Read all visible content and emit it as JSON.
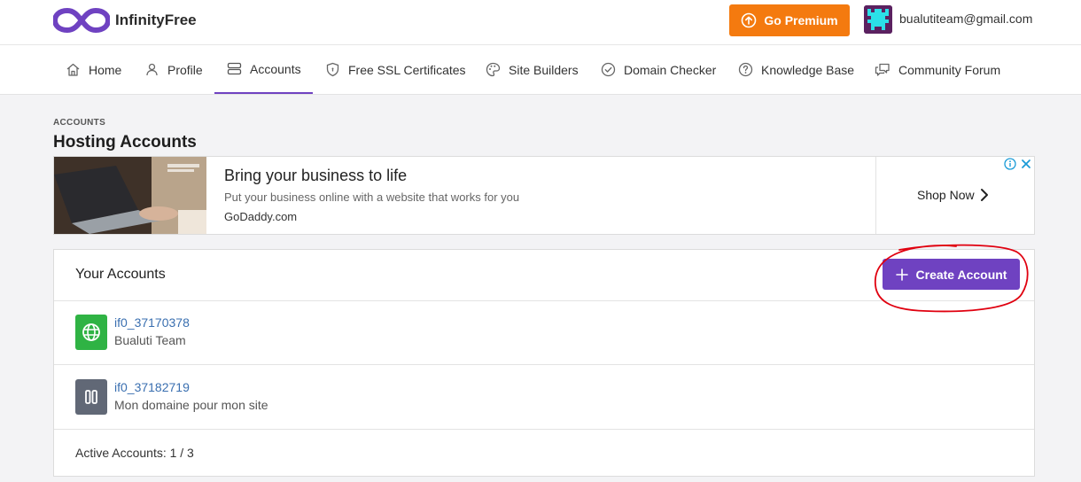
{
  "brand": {
    "name": "InfinityFree"
  },
  "header": {
    "premium_label": "Go Premium",
    "user_email": "bualutiteam@gmail.com"
  },
  "nav": {
    "items": [
      {
        "label": "Home",
        "icon": "home-icon"
      },
      {
        "label": "Profile",
        "icon": "user-icon"
      },
      {
        "label": "Accounts",
        "icon": "server-icon",
        "active": true
      },
      {
        "label": "Free SSL Certificates",
        "icon": "shield-icon"
      },
      {
        "label": "Site Builders",
        "icon": "palette-icon"
      },
      {
        "label": "Domain Checker",
        "icon": "check-circle-icon"
      },
      {
        "label": "Knowledge Base",
        "icon": "question-circle-icon"
      },
      {
        "label": "Community Forum",
        "icon": "chat-icon"
      }
    ]
  },
  "page": {
    "breadcrumb": "ACCOUNTS",
    "title": "Hosting Accounts"
  },
  "ad": {
    "title": "Bring your business to life",
    "subtitle": "Put your business online with a website that works for you",
    "domain": "GoDaddy.com",
    "cta": "Shop Now"
  },
  "accounts_card": {
    "title": "Your Accounts",
    "create_label": "Create Account",
    "rows": [
      {
        "id": "if0_37170378",
        "name": "Bualuti Team",
        "status": "active",
        "icon": "globe-icon",
        "color": "#2fb344"
      },
      {
        "id": "if0_37182719",
        "name": "Mon domaine pour mon site",
        "status": "suspended",
        "icon": "pause-icon",
        "color": "#616876"
      }
    ],
    "footer": "Active Accounts: 1 / 3"
  },
  "colors": {
    "accent": "#6f42c1",
    "premium": "#f47a0f",
    "link": "#3a6fb0",
    "annotation": "#e0000f"
  }
}
